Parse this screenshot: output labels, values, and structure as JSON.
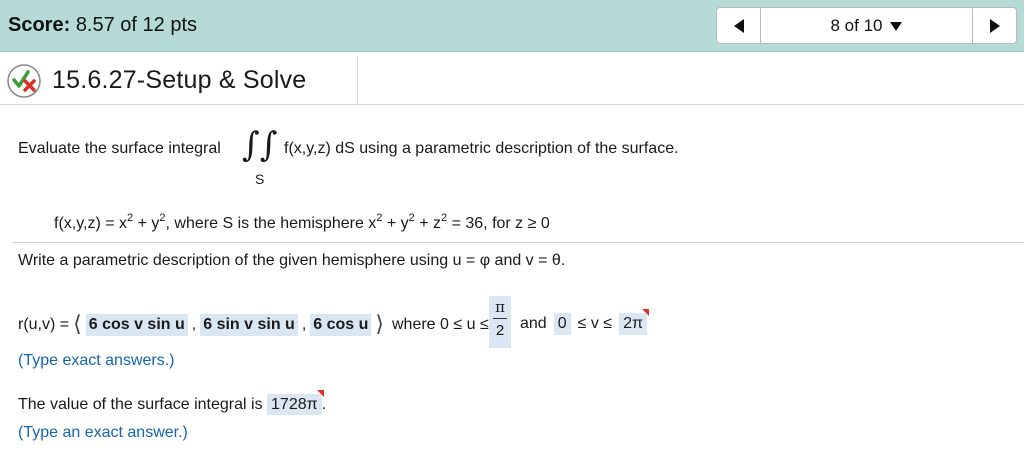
{
  "header": {
    "score_label": "Score:",
    "score_value": "8.57 of 12 pts",
    "nav_position": "8 of 10",
    "prev_icon": "triangle-left-icon",
    "next_icon": "triangle-right-icon",
    "dropdown_icon": "triangle-down-icon"
  },
  "question": {
    "status_icon": "partial-credit-icon",
    "title": "15.6.27-Setup & Solve"
  },
  "problem": {
    "intro_before": "Evaluate the surface integral",
    "intro_after": "f(x,y,z) dS using a parametric description of the surface.",
    "integral_subscript": "S",
    "function_def": "f(x,y,z) = x",
    "function_mid": " + y",
    "where_text": ", where S is the hemisphere x",
    "plus_y": " + y",
    "plus_z": " + z",
    "equals": " = 36, for z ≥ 0",
    "exponent": "2"
  },
  "part1": {
    "prompt": "Write a parametric description of the given hemisphere using u = φ and v = θ.",
    "r_label": "r(u,v) =",
    "comp1": "6 cos v sin u",
    "comp2": "6 sin v sin u",
    "comp3": "6 cos u",
    "comma": ",",
    "where_text": "where 0 ≤ u ≤",
    "u_upper_num": "π",
    "u_upper_den": "2",
    "and_text": "and",
    "v_lower": "0",
    "v_leq": "≤ v ≤",
    "v_upper": "2π",
    "hint": "(Type exact answers.)"
  },
  "part2": {
    "prompt": "The value of the surface integral is",
    "answer": "1728π",
    "period": ".",
    "hint": "(Type an exact answer.)"
  },
  "colors": {
    "header_bg": "#b6dbd7",
    "answer_bg": "#dbe6f3",
    "hint_blue": "#1565b0",
    "marker_red": "#d9332b"
  }
}
